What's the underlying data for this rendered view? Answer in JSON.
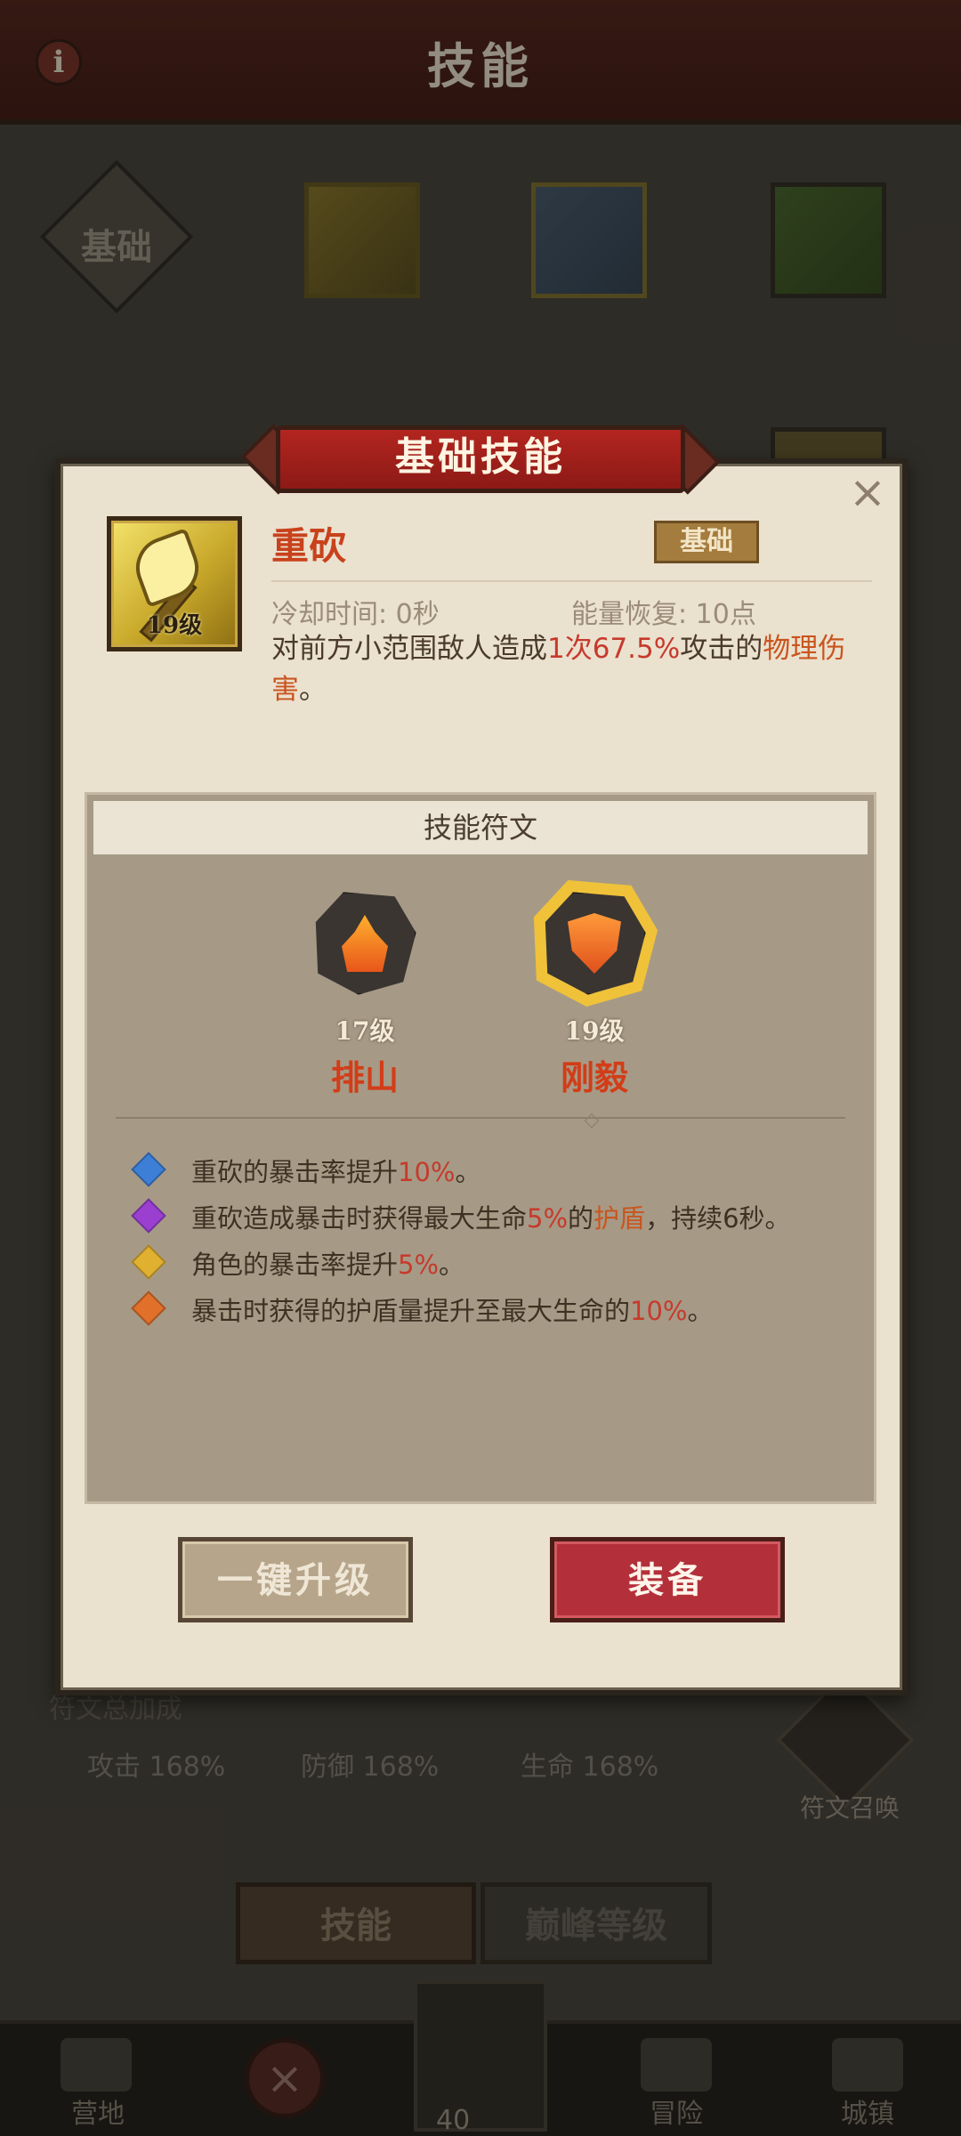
{
  "screen": {
    "title": "技能",
    "info_icon": "i",
    "tabs": {
      "basic": "基础"
    },
    "rune_bonus": {
      "title": "符文总加成",
      "attack": "攻击  168%",
      "defense": "防御  168%",
      "hp": "生命  168%"
    },
    "rune_summon_label": "符文召唤",
    "bottom_tabs": {
      "skill": "技能",
      "peak": "巅峰等级"
    },
    "nav": {
      "camp": "营地",
      "adventure": "冒险",
      "town": "城镇",
      "count": "40",
      "close_icon": "×"
    }
  },
  "modal": {
    "title": "基础技能",
    "close_icon": "×",
    "skill": {
      "name": "重砍",
      "tag": "基础",
      "level": "19级",
      "cooldown": "冷却时间: 0秒",
      "energy": "能量恢复: 10点",
      "desc_prefix": "对前方小范围敌人造成",
      "desc_count": "1次",
      "desc_pct": "67.5%",
      "desc_mid": "攻击的",
      "desc_type": "物理伤害",
      "desc_end": "。"
    },
    "runes": {
      "header": "技能符文",
      "items": [
        {
          "level": "17级",
          "name": "排山"
        },
        {
          "level": "19级",
          "name": "刚毅"
        }
      ],
      "sep_mark": "◇"
    },
    "effects": [
      {
        "prefix": "重砍的暴击率提升",
        "value": "10%",
        "mid": "",
        "highlight": "",
        "suffix": "。",
        "color": "#3d7fd6"
      },
      {
        "prefix": "重砍造成暴击时获得最大生命",
        "value": "5%",
        "mid": "的",
        "highlight": "护盾",
        "suffix": "，持续6秒。",
        "color": "#9a3fd0"
      },
      {
        "prefix": "角色的暴击率提升",
        "value": "5%",
        "mid": "",
        "highlight": "",
        "suffix": "。",
        "color": "#e0b030"
      },
      {
        "prefix": "暴击时获得的护盾量提升至最大生命的",
        "value": "10%",
        "mid": "",
        "highlight": "",
        "suffix": "。",
        "color": "#e0702a"
      }
    ],
    "buttons": {
      "upgrade": "一键升级",
      "equip": "装备"
    }
  },
  "colors": {
    "accent_red": "#c63a2c",
    "accent_orange": "#c9551e",
    "rune_glow": "#f0c23a"
  }
}
